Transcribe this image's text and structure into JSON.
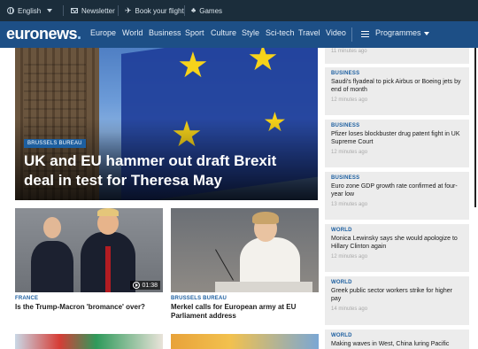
{
  "topbar": {
    "language": "English",
    "newsletter": "Newsletter",
    "flight": "Book your flight",
    "games": "Games"
  },
  "nav": {
    "logo_main": "euronews",
    "logo_dot": ".",
    "items": [
      "Europe",
      "World",
      "Business",
      "Sport",
      "Culture",
      "Style",
      "Sci-tech",
      "Travel",
      "Video"
    ],
    "programmes": "Programmes"
  },
  "hero": {
    "category": "BRUSSELS BUREAU",
    "headline": "UK and EU hammer out draft Brexit deal in test for Theresa May"
  },
  "stories": [
    {
      "category": "FRANCE",
      "title": "Is the Trump-Macron 'bromance' over?",
      "duration": "01:38"
    },
    {
      "category": "BRUSSELS BUREAU",
      "title": "Merkel calls for European army at EU Parliament address"
    }
  ],
  "sidebar": {
    "top_time": "11 minutes ago",
    "items": [
      {
        "category": "BUSINESS",
        "title": "Saudi's flyadeal to pick Airbus or Boeing jets by end of month",
        "time": "12 minutes ago"
      },
      {
        "category": "BUSINESS",
        "title": "Pfizer loses blockbuster drug patent fight in UK Supreme Court",
        "time": "12 minutes ago"
      },
      {
        "category": "BUSINESS",
        "title": "Euro zone GDP growth rate confirmed at four-year low",
        "time": "13 minutes ago"
      },
      {
        "category": "WORLD",
        "title": "Monica Lewinsky says she would apologize to Hillary Clinton again",
        "time": "12 minutes ago"
      },
      {
        "category": "WORLD",
        "title": "Greek public sector workers strike for higher pay",
        "time": "14 minutes ago"
      },
      {
        "category": "WORLD",
        "title": "Making waves in West, China luring Pacific",
        "time": ""
      }
    ]
  },
  "colors": {
    "topbar": "#1b2d3b",
    "navbar": "#1d4f86",
    "accent": "#1d5fa0",
    "sidebar_bg": "#ececec"
  }
}
